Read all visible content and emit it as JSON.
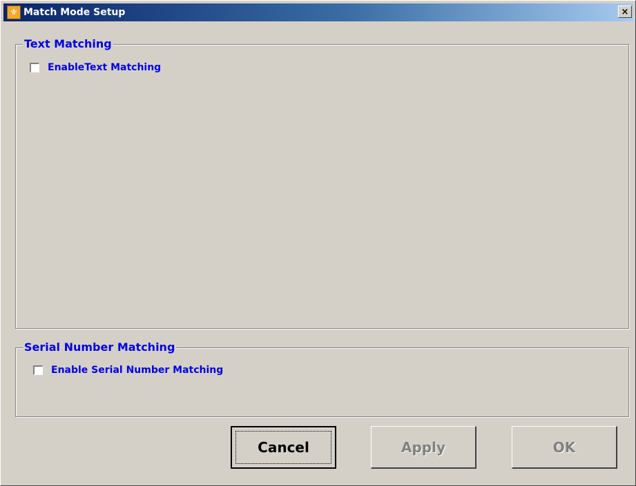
{
  "window": {
    "title": "Match Mode Setup",
    "close_label": "×"
  },
  "text_matching": {
    "legend": "Text Matching",
    "checkbox_label": "EnableText Matching",
    "checked": false
  },
  "serial_matching": {
    "legend": "Serial Number Matching",
    "checkbox_label": "Enable Serial Number Matching",
    "checked": false
  },
  "buttons": {
    "cancel_label": "Cancel",
    "apply_label": "Apply",
    "ok_label": "OK"
  },
  "colors": {
    "face": "#d4d0c8",
    "label_blue": "#0000e0",
    "title_gradient_start": "#0a246a",
    "title_gradient_end": "#a6caf0",
    "disabled_text": "#808080"
  },
  "icons": {
    "app": "match-mode-app-icon",
    "close": "close-icon"
  }
}
